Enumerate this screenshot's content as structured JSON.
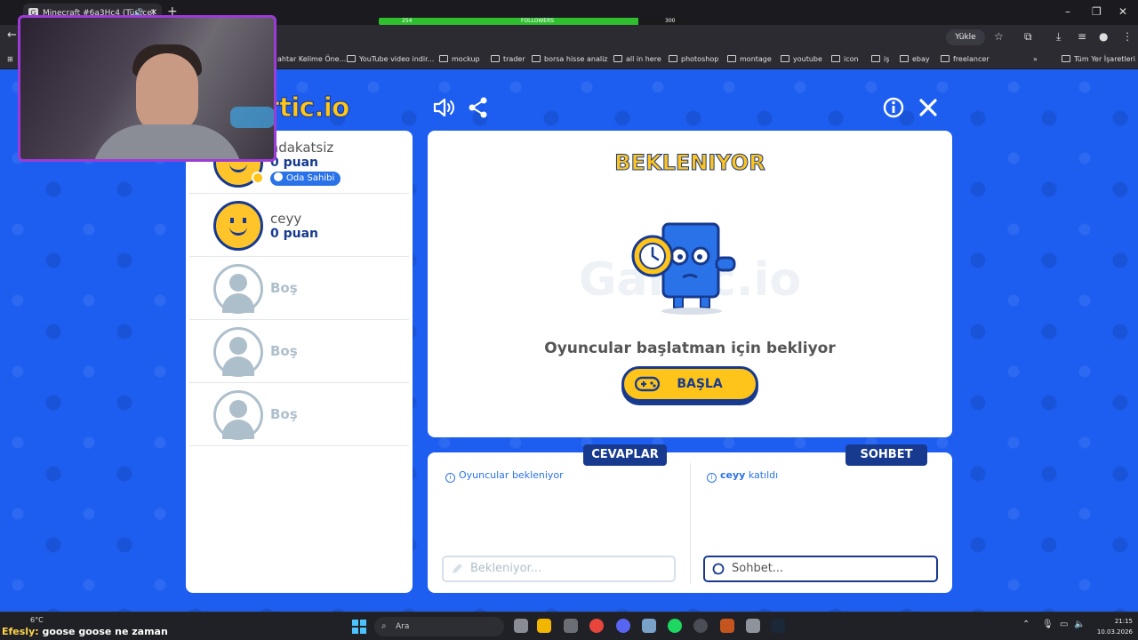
{
  "browser": {
    "tab_title": "Minecraft #6a3Hc4 (Türkçe)",
    "tab_favicon": "G",
    "followers_label": "FOLLOWERS",
    "followers_current": "254",
    "followers_goal": "300",
    "followers_progress": 0.85,
    "install_label": "Yükle",
    "bookmarks": [
      {
        "label": "ahtar Kelime Öne..."
      },
      {
        "label": "YouTube video indir..."
      },
      {
        "label": "mockup"
      },
      {
        "label": "trader"
      },
      {
        "label": "borsa hisse analiz"
      },
      {
        "label": "all in here"
      },
      {
        "label": "photoshop"
      },
      {
        "label": "montage"
      },
      {
        "label": "youtube"
      },
      {
        "label": "icon"
      },
      {
        "label": "iş"
      },
      {
        "label": "ebay"
      },
      {
        "label": "freelancer"
      }
    ],
    "all_bookmarks_label": "Tüm Yer İşaretleri"
  },
  "game": {
    "logo_text": "rtic.io",
    "players": [
      {
        "name": "adakatsiz",
        "score": "0 puan",
        "badge": "Oda Sahibi"
      },
      {
        "name": "ceyy",
        "score": "0 puan"
      },
      {
        "empty_label": "Boş"
      },
      {
        "empty_label": "Boş"
      },
      {
        "empty_label": "Boş"
      }
    ],
    "stage": {
      "title": "BEKLENIYOR",
      "message": "Oyuncular başlatman için bekliyor",
      "start_label": "BAŞLA"
    },
    "answers": {
      "tab_label": "CEVAPLAR",
      "info": "Oyuncular bekleniyor",
      "placeholder": "Bekleniyor..."
    },
    "chat": {
      "tab_label": "SOHBET",
      "join_user": "ceyy",
      "join_text": "katıldı",
      "placeholder": "Sohbet..."
    }
  },
  "taskbar": {
    "weather": "6°C",
    "chat_user": "Efesly:",
    "chat_message": "goose goose ne zaman",
    "search_label": "Ara",
    "time": "21:15",
    "date": "10.03.2026"
  },
  "colors": {
    "game_bg": "#1d5ef0",
    "brand_yellow": "#ffc419",
    "brand_navy": "#173a8f",
    "accent_blue": "#2a72e8",
    "cam_border": "#9d3bd8"
  }
}
